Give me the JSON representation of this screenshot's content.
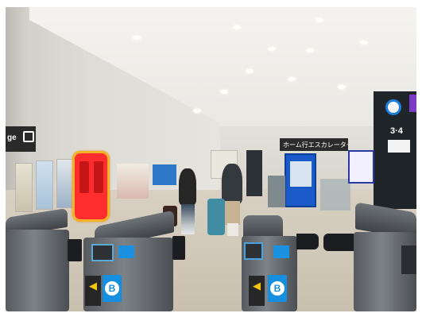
{
  "signs": {
    "left_wall_sign": "ge",
    "escalator_sign": "ホーム行エスカレーター",
    "platform_sign": "3·4"
  },
  "gates": {
    "badge_label": "B"
  },
  "colors": {
    "vending_highlight": "#ff2d2d",
    "highlight_border": "#f3b22a",
    "kiosk_blue": "#1b5bc9",
    "gate_panel_blue": "#168fe0"
  }
}
